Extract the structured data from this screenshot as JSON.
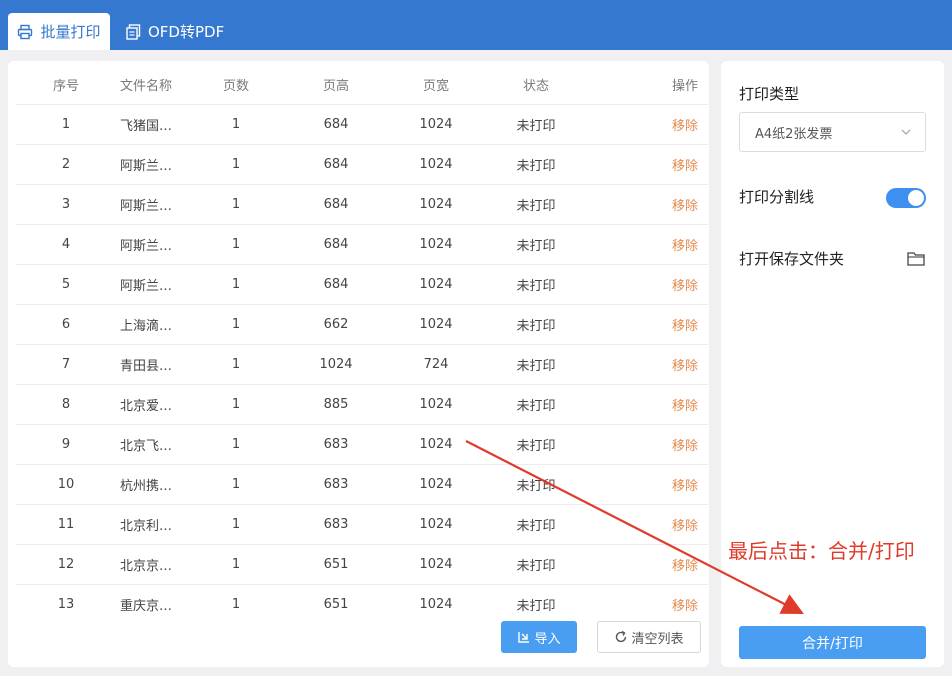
{
  "tabs": [
    {
      "label": "批量打印",
      "icon": "printer-icon"
    },
    {
      "label": "OFD转PDF",
      "icon": "document-icon"
    }
  ],
  "table": {
    "headers": [
      "序号",
      "文件名称",
      "页数",
      "页高",
      "页宽",
      "状态",
      "操作"
    ],
    "rows": [
      [
        "1",
        "飞猪国…",
        "1",
        "684",
        "1024",
        "未打印",
        "移除"
      ],
      [
        "2",
        "阿斯兰…",
        "1",
        "684",
        "1024",
        "未打印",
        "移除"
      ],
      [
        "3",
        "阿斯兰…",
        "1",
        "684",
        "1024",
        "未打印",
        "移除"
      ],
      [
        "4",
        "阿斯兰…",
        "1",
        "684",
        "1024",
        "未打印",
        "移除"
      ],
      [
        "5",
        "阿斯兰…",
        "1",
        "684",
        "1024",
        "未打印",
        "移除"
      ],
      [
        "6",
        "上海滴…",
        "1",
        "662",
        "1024",
        "未打印",
        "移除"
      ],
      [
        "7",
        "青田县…",
        "1",
        "1024",
        "724",
        "未打印",
        "移除"
      ],
      [
        "8",
        "北京爱…",
        "1",
        "885",
        "1024",
        "未打印",
        "移除"
      ],
      [
        "9",
        "北京飞…",
        "1",
        "683",
        "1024",
        "未打印",
        "移除"
      ],
      [
        "10",
        "杭州携…",
        "1",
        "683",
        "1024",
        "未打印",
        "移除"
      ],
      [
        "11",
        "北京利…",
        "1",
        "683",
        "1024",
        "未打印",
        "移除"
      ],
      [
        "12",
        "北京京…",
        "1",
        "651",
        "1024",
        "未打印",
        "移除"
      ],
      [
        "13",
        "重庆京…",
        "1",
        "651",
        "1024",
        "未打印",
        "移除"
      ]
    ]
  },
  "buttons": {
    "import": "导入",
    "clear": "清空列表",
    "merge_print": "合并/打印"
  },
  "settings": {
    "print_type_label": "打印类型",
    "print_type_value": "A4纸2张发票",
    "split_line_label": "打印分割线",
    "split_line_enabled": true,
    "open_folder_label": "打开保存文件夹"
  },
  "annotation": {
    "text": "最后点击：合并/打印",
    "color": "#e03a2a"
  },
  "colors": {
    "accent": "#3578cf",
    "button": "#4a9ef2",
    "remove_link": "#e28a4b"
  }
}
